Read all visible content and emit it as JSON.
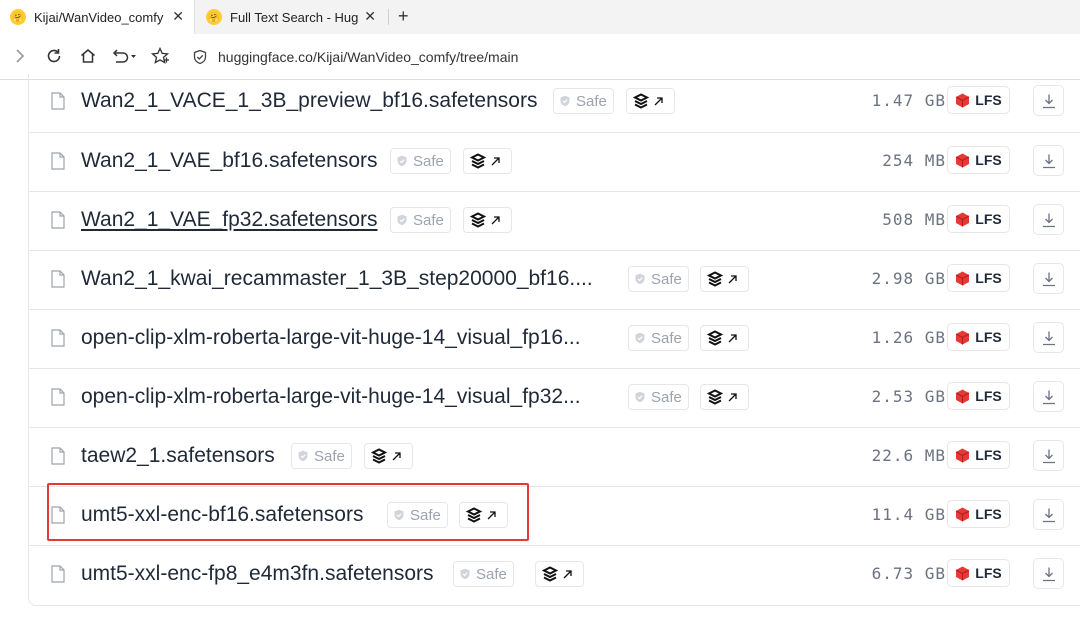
{
  "browser": {
    "tabs": [
      {
        "title": "Kijai/WanVideo_comfy",
        "close": "✕"
      },
      {
        "title": "Full Text Search - Hug",
        "close": "✕"
      }
    ],
    "new_tab": "+",
    "address": "huggingface.co/Kijai/WanVideo_comfy/tree/main"
  },
  "files": [
    {
      "name": "Wan2_1_VACE_1_3B_preview_bf16.safetensors",
      "safe": "Safe",
      "size": "1.47 GB",
      "lfs": "LFS",
      "underline": false,
      "highlight": false
    },
    {
      "name": "Wan2_1_VAE_bf16.safetensors",
      "safe": "Safe",
      "size": "254 MB",
      "lfs": "LFS",
      "underline": false,
      "highlight": false
    },
    {
      "name": "Wan2_1_VAE_fp32.safetensors",
      "safe": "Safe",
      "size": "508 MB",
      "lfs": "LFS",
      "underline": true,
      "highlight": false
    },
    {
      "name": "Wan2_1_kwai_recammaster_1_3B_step20000_bf16....",
      "safe": "Safe",
      "size": "2.98 GB",
      "lfs": "LFS",
      "underline": false,
      "highlight": false
    },
    {
      "name": "open-clip-xlm-roberta-large-vit-huge-14_visual_fp16...",
      "safe": "Safe",
      "size": "1.26 GB",
      "lfs": "LFS",
      "underline": false,
      "highlight": false
    },
    {
      "name": "open-clip-xlm-roberta-large-vit-huge-14_visual_fp32...",
      "safe": "Safe",
      "size": "2.53 GB",
      "lfs": "LFS",
      "underline": false,
      "highlight": false
    },
    {
      "name": "taew2_1.safetensors",
      "safe": "Safe",
      "size": "22.6 MB",
      "lfs": "LFS",
      "underline": false,
      "highlight": false
    },
    {
      "name": "umt5-xxl-enc-bf16.safetensors",
      "safe": "Safe",
      "size": "11.4 GB",
      "lfs": "LFS",
      "underline": false,
      "highlight": true
    },
    {
      "name": "umt5-xxl-enc-fp8_e4m3fn.safetensors",
      "safe": "Safe",
      "size": "6.73 GB",
      "lfs": "LFS",
      "underline": false,
      "highlight": false
    }
  ],
  "colors": {
    "highlight": "#e53935",
    "lfs_icon": "#e53935",
    "favicon": "#ffcc33"
  },
  "icons": [
    "file-icon",
    "shield-check-icon",
    "scan-link-icon",
    "lfs-cube-icon",
    "download-icon"
  ]
}
